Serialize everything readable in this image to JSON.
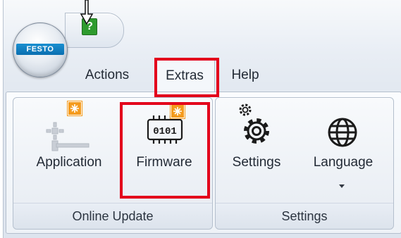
{
  "app": {
    "logo_text": "FESTO",
    "help_glyph": "?"
  },
  "menu_tabs": [
    {
      "label": "Actions"
    },
    {
      "label": "Extras"
    },
    {
      "label": "Help"
    }
  ],
  "ribbon": {
    "groups": [
      {
        "label": "Online Update",
        "buttons": [
          {
            "label": "Application",
            "icon": "application-icon",
            "badge": "update-badge-icon"
          },
          {
            "label": "Firmware",
            "icon": "firmware-chip-icon",
            "badge": "update-badge-icon"
          }
        ]
      },
      {
        "label": "Settings",
        "buttons": [
          {
            "label": "Settings",
            "icon": "gear-icon"
          },
          {
            "label": "Language",
            "icon": "globe-icon",
            "has_dropdown": true
          }
        ]
      }
    ]
  },
  "colors": {
    "highlight": "#e3001b",
    "badge": "#f49b1e",
    "help_button": "#2e9b2e",
    "logo_blue": "#0b6fb0"
  }
}
